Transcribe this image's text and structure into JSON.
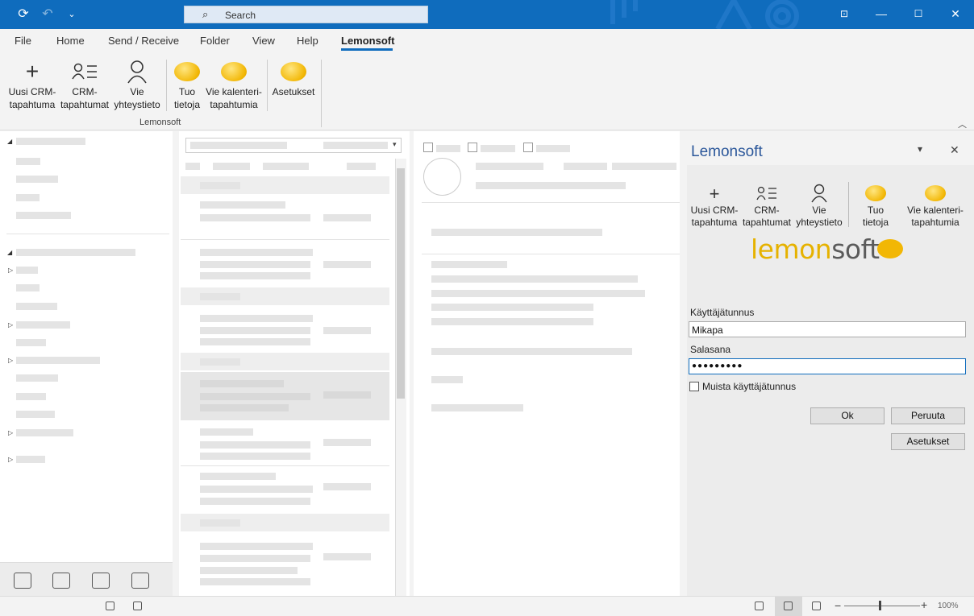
{
  "titlebar": {
    "search_placeholder": "Search",
    "icons": [
      "sync-icon",
      "undo-icon",
      "quick-access-dropdown-icon",
      "ribbon-display-icon",
      "minimize-icon",
      "maximize-icon",
      "close-icon"
    ]
  },
  "menu": {
    "items": [
      "File",
      "Home",
      "Send / Receive",
      "Folder",
      "View",
      "Help",
      "Lemonsoft"
    ],
    "active": "Lemonsoft"
  },
  "ribbon": {
    "group_label": "Lemonsoft",
    "buttons": [
      {
        "line1": "Uusi CRM-",
        "line2": "tapahtuma",
        "icon": "plus-icon"
      },
      {
        "line1": "CRM-",
        "line2": "tapahtumat",
        "icon": "contact-list-icon"
      },
      {
        "line1": "Vie",
        "line2": "yhteystieto",
        "icon": "person-icon"
      },
      {
        "line1": "Tuo",
        "line2": "tietoja",
        "icon": "lemon-icon"
      },
      {
        "line1": "Vie kalenteri-",
        "line2": "tapahtumia",
        "icon": "lemon-icon"
      },
      {
        "line1": "Asetukset",
        "line2": "",
        "icon": "lemon-icon"
      }
    ]
  },
  "pane": {
    "title": "Lemonsoft",
    "buttons": [
      {
        "line1": "Uusi CRM-",
        "line2": "tapahtuma"
      },
      {
        "line1": "CRM-",
        "line2": "tapahtumat"
      },
      {
        "line1": "Vie",
        "line2": "yhteystieto"
      },
      {
        "line1": "Tuo",
        "line2": "tietoja"
      },
      {
        "line1": "Vie kalenteri-",
        "line2": "tapahtumia"
      }
    ],
    "logo_part1": "lemon",
    "logo_part2": "soft",
    "username_label": "Käyttäjätunnus",
    "username_value": "Mikapa",
    "password_label": "Salasana",
    "password_value": "●●●●●●●●●",
    "remember_label": "Muista käyttäjätunnus",
    "ok_label": "Ok",
    "cancel_label": "Peruuta",
    "settings_label": "Asetukset",
    "brand_color": "#f2b705"
  },
  "status": {
    "zoom": "100%"
  },
  "colors": {
    "accent": "#0f6cbd",
    "pane_title": "#2b579a"
  }
}
